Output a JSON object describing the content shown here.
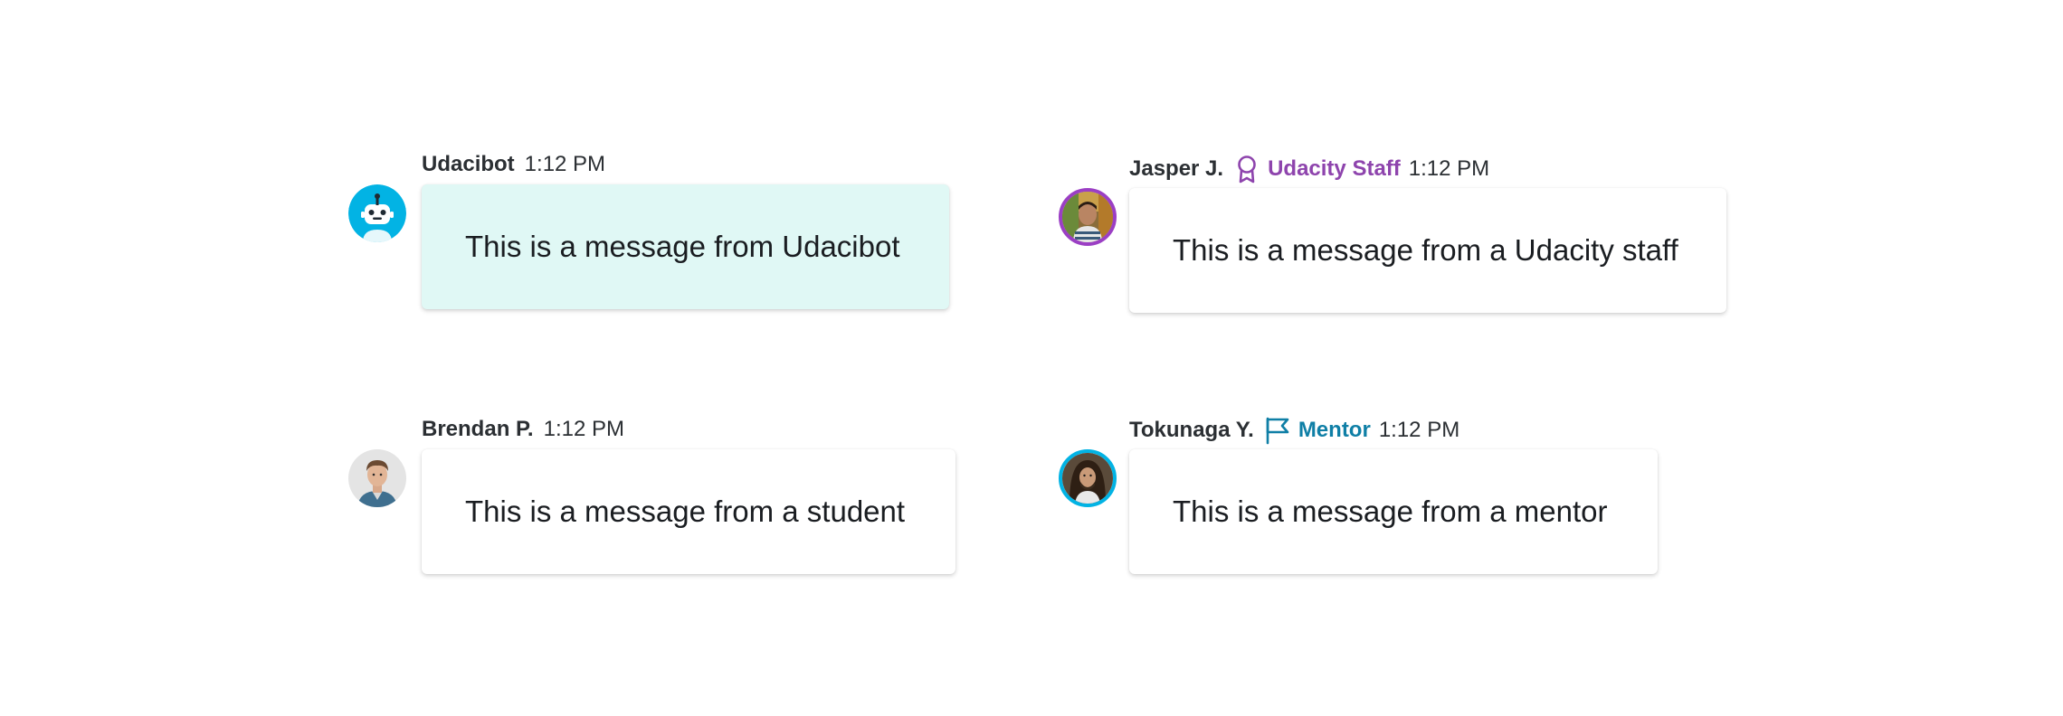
{
  "messages": [
    {
      "author": "Udacibot",
      "role": "",
      "time": "1:12 PM",
      "text": "This is a message from Udacibot",
      "avatar": "robot-avatar",
      "bubble_color": "#e0f8f5"
    },
    {
      "author": "Jasper J.",
      "role": "Udacity Staff",
      "role_icon": "award-ribbon-icon",
      "role_color": "#8e44ad",
      "time": "1:12 PM",
      "text": "This is a message from a Udacity staff",
      "avatar": "staff-avatar",
      "avatar_ring_color": "#9b3fc4"
    },
    {
      "author": "Brendan P.",
      "role": "",
      "time": "1:12 PM",
      "text": "This is a message from a student",
      "avatar": "student-avatar"
    },
    {
      "author": "Tokunaga Y.",
      "role": "Mentor",
      "role_icon": "flag-icon",
      "role_color": "#0f7fa6",
      "time": "1:12 PM",
      "text": "This is a message from a mentor",
      "avatar": "mentor-avatar",
      "avatar_ring_color": "#02b3e4"
    }
  ]
}
